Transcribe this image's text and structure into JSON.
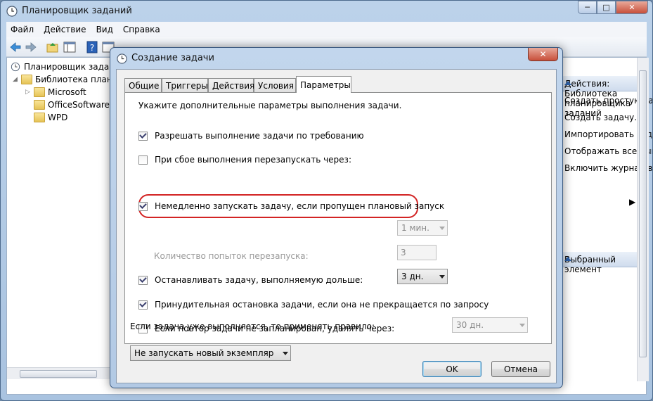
{
  "main": {
    "title": "Планировщик заданий",
    "menu": [
      "Файл",
      "Действие",
      "Вид",
      "Справка"
    ],
    "caption": {
      "minimize": "─",
      "maximize": "□",
      "close": "✕"
    },
    "tree": {
      "root": "Планировщик заданий",
      "library": "Библиотека планировщика заданий",
      "children": [
        "Microsoft",
        "OfficeSoftwareProtectionPlatform",
        "WPD"
      ]
    },
    "actions": {
      "header1": "Действия: Библиотека планировщика заданий",
      "items": [
        "Создать простую задачу...",
        "Создать задачу...",
        "Импортировать задачу...",
        "Отображать все выполняемые задачи",
        "Включить журнал всех заданий"
      ],
      "header2": "Выбранный элемент"
    }
  },
  "dialog": {
    "title": "Создание задачи",
    "close": "✕",
    "tabs": [
      "Общие",
      "Триггеры",
      "Действия",
      "Условия",
      "Параметры"
    ],
    "active_tab": "Параметры",
    "description": "Укажите дополнительные параметры выполнения задачи.",
    "options": {
      "allow_on_demand": {
        "label": "Разрешать выполнение задачи по требованию",
        "checked": true
      },
      "run_missed": {
        "label": "Немедленно запускать задачу, если пропущен плановый запуск",
        "checked": true
      },
      "restart_on_fail": {
        "label": "При сбое выполнения перезапускать через:",
        "checked": false,
        "value": "1 мин."
      },
      "restart_attempts": {
        "label": "Количество попыток перезапуска:",
        "value": "3"
      },
      "stop_long": {
        "label": "Останавливать задачу, выполняемую дольше:",
        "checked": true,
        "value": "3 дн."
      },
      "force_stop": {
        "label": "Принудительная остановка задачи, если она не прекращается по запросу",
        "checked": true
      },
      "delete_after": {
        "label": "Если повтор задачи не запланирован, удалять через:",
        "checked": false,
        "value": "30 дн."
      }
    },
    "rule_label": "Если задача уже выполняется, то применять правило:",
    "rule_value": "Не запускать новый экземпляр",
    "buttons": {
      "ok": "OK",
      "cancel": "Отмена"
    },
    "highlight_color": "#d32424"
  }
}
